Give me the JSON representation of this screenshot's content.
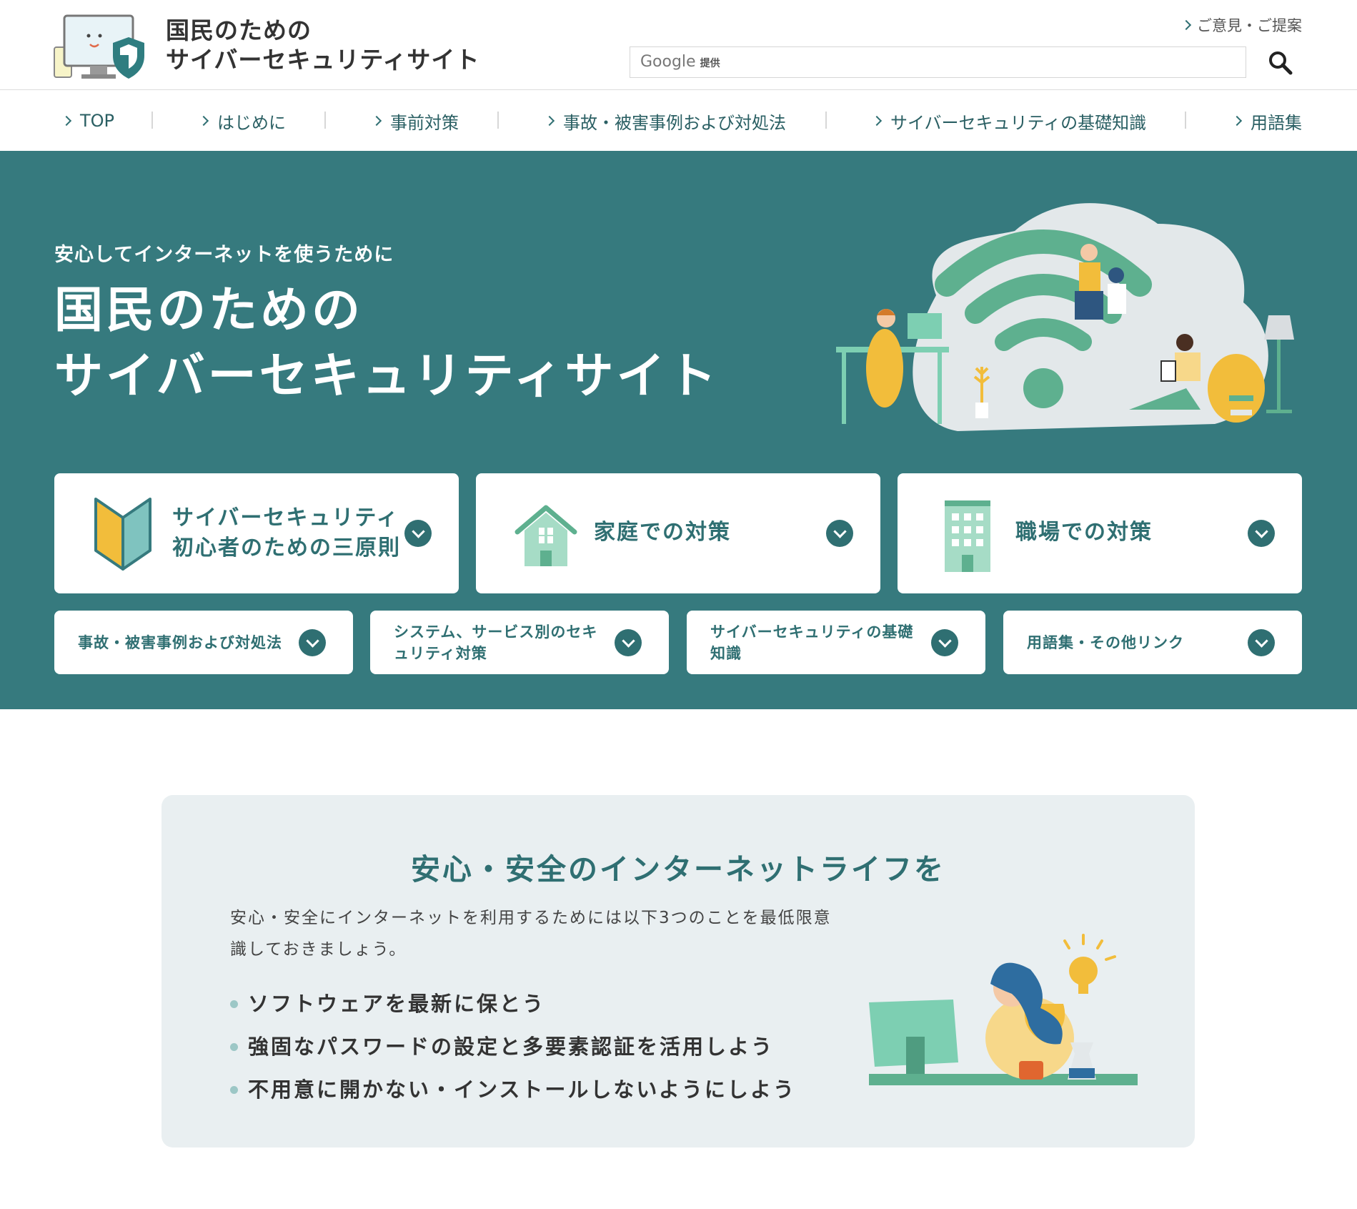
{
  "header": {
    "title_line1": "国民のための",
    "title_line2": "サイバーセキュリティサイト",
    "feedback_label": "ご意見・ご提案",
    "search": {
      "brand": "Google",
      "brand_suffix": "提供",
      "value": ""
    }
  },
  "nav": {
    "items": [
      {
        "label": "TOP"
      },
      {
        "label": "はじめに"
      },
      {
        "label": "事前対策"
      },
      {
        "label": "事故・被害事例および対処法"
      },
      {
        "label": "サイバーセキュリティの基礎知識"
      },
      {
        "label": "用語集"
      }
    ]
  },
  "hero": {
    "subtitle": "安心してインターネットを使うために",
    "title_line1": "国民のための",
    "title_line2": "サイバーセキュリティサイト",
    "big_cards": [
      {
        "label_line1": "サイバーセキュリティ",
        "label_line2": "初心者のための三原則",
        "icon": "beginner-mark-icon"
      },
      {
        "label_line1": "家庭での対策",
        "label_line2": "",
        "icon": "house-icon"
      },
      {
        "label_line1": "職場での対策",
        "label_line2": "",
        "icon": "building-icon"
      }
    ],
    "small_cards": [
      {
        "label": "事故・被害事例および対処法"
      },
      {
        "label": "システム、サービス別のセキュリティ対策"
      },
      {
        "label": "サイバーセキュリティの基礎知識"
      },
      {
        "label": "用語集・その他リンク"
      }
    ]
  },
  "info": {
    "heading": "安心・安全のインターネットライフを",
    "text": "安心・安全にインターネットを利用するためには以下3つのことを最低限意識しておきましょう。",
    "items": [
      "ソフトウェアを最新に保とう",
      "強固なパスワードの設定と多要素認証を活用しよう",
      "不用意に開かない・インストールしないようにしよう"
    ]
  },
  "colors": {
    "brand_teal": "#367a7e",
    "accent_teal": "#2f6f72",
    "info_bg": "#e9eff1",
    "illustration_green": "#5eb08f",
    "illustration_yellow": "#f2bd3b"
  }
}
